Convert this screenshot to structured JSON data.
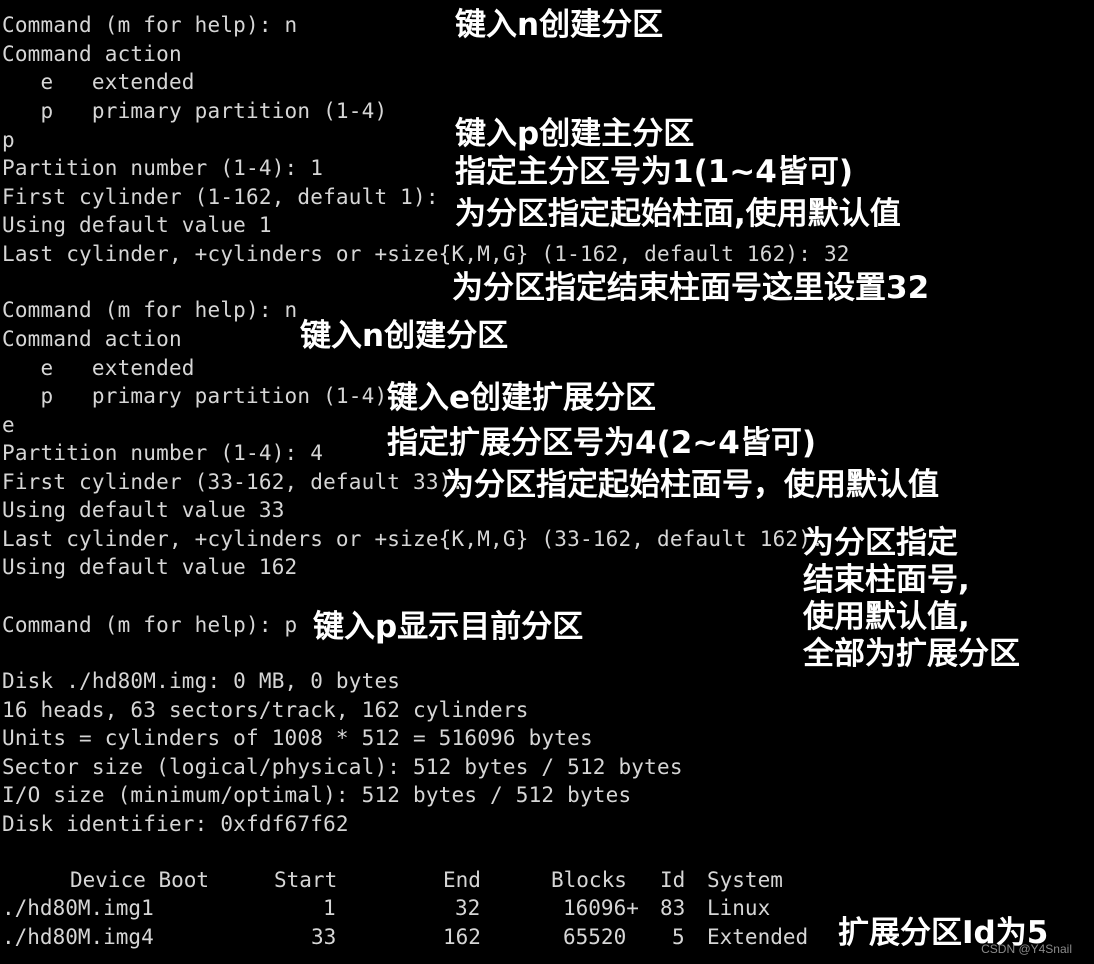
{
  "terminal": {
    "lines": [
      "Command (m for help): n",
      "Command action",
      "   e   extended",
      "   p   primary partition (1-4)",
      "p",
      "Partition number (1-4): 1",
      "First cylinder (1-162, default 1):",
      "Using default value 1",
      "Last cylinder, +cylinders or +size{K,M,G} (1-162, default 162): 32",
      "Command (m for help): n",
      "Command action",
      "   e   extended",
      "   p   primary partition (1-4)",
      "e",
      "Partition number (1-4): 4",
      "First cylinder (33-162, default 33):",
      "Using default value 33",
      "Last cylinder, +cylinders or +size{K,M,G} (33-162, default 162):",
      "Using default value 162",
      "Command (m for help): p",
      "Disk ./hd80M.img: 0 MB, 0 bytes",
      "16 heads, 63 sectors/track, 162 cylinders",
      "Units = cylinders of 1008 * 512 = 516096 bytes",
      "Sector size (logical/physical): 512 bytes / 512 bytes",
      "I/O size (minimum/optimal): 512 bytes / 512 bytes",
      "Disk identifier: 0xfdf67f62"
    ],
    "table": {
      "headers": [
        "Device Boot",
        "Start",
        "End",
        "Blocks",
        "Id",
        "System"
      ],
      "rows": [
        [
          "./hd80M.img1",
          "1",
          "32",
          "16096+",
          "83",
          "Linux"
        ],
        [
          "./hd80M.img4",
          "33",
          "162",
          "65520",
          "5",
          "Extended"
        ]
      ]
    }
  },
  "annotations": [
    "键入n创建分区",
    "键入p创建主分区",
    "指定主分区号为1(1~4皆可)",
    "为分区指定起始柱面,使用默认值",
    "为分区指定结束柱面号这里设置32",
    "键入n创建分区",
    "键入e创建扩展分区",
    "指定扩展分区号为4(2~4皆可)",
    "为分区指定起始柱面号，使用默认值",
    "为分区指定",
    "结束柱面号,",
    "使用默认值,",
    "全部为扩展分区",
    "键入p显示目前分区",
    "扩展分区Id为5"
  ],
  "watermark": "CSDN @Y4Snail"
}
